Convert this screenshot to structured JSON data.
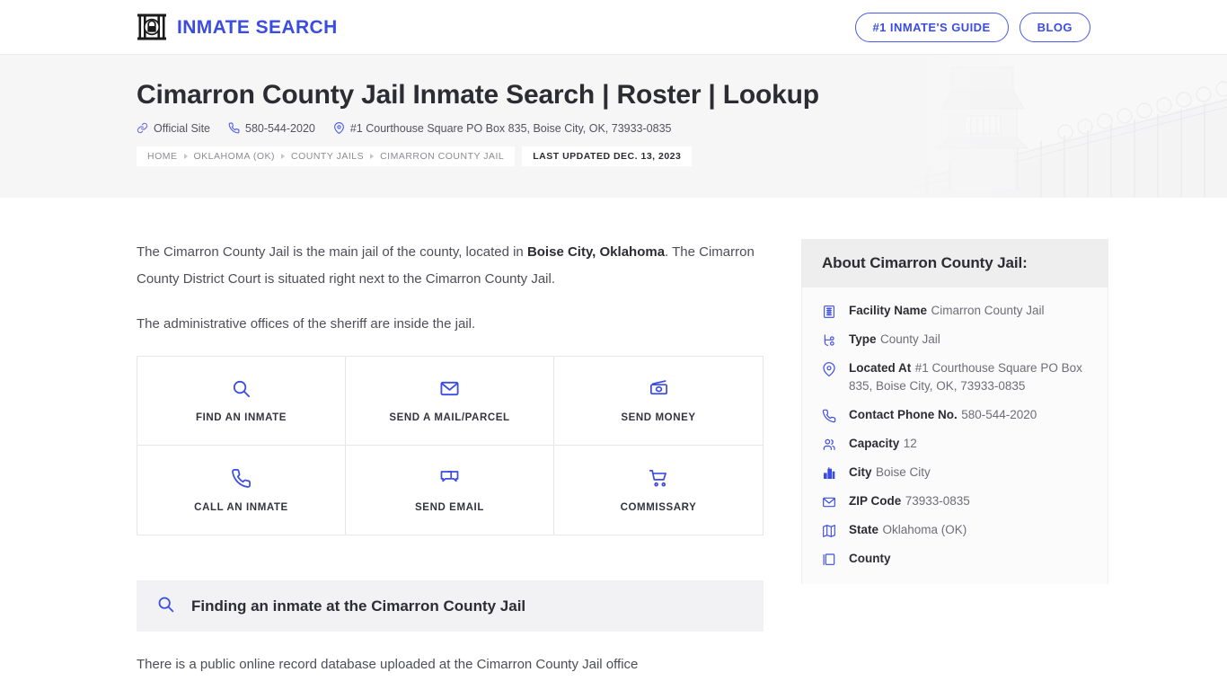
{
  "header": {
    "brand_name": "INMATE SEARCH",
    "logo_icon": "jail-padlock-icon",
    "buttons": [
      {
        "label": "#1 INMATE'S GUIDE",
        "name": "inmates-guide-button"
      },
      {
        "label": "BLOG",
        "name": "blog-button"
      }
    ]
  },
  "hero": {
    "title": "Cimarron County Jail Inmate Search | Roster | Lookup",
    "meta": [
      {
        "icon": "link-icon",
        "text": "Official Site"
      },
      {
        "icon": "phone-icon",
        "text": "580-544-2020"
      },
      {
        "icon": "map-pin-icon",
        "text": "#1 Courthouse Square PO Box 835, Boise City, OK, 73933-0835"
      }
    ],
    "breadcrumb": [
      "HOME",
      "OKLAHOMA (OK)",
      "COUNTY JAILS",
      "CIMARRON COUNTY JAIL"
    ],
    "last_updated": "LAST UPDATED DEC. 13, 2023",
    "background_image": "prison-watchtower-fence-watermark"
  },
  "main": {
    "paragraph_1_a": "The Cimarron County Jail is the main jail of the county, located in ",
    "paragraph_1_b": "Boise City, Oklahoma",
    "paragraph_1_c": ". The Cimarron County District Court is situated right next to the Cimarron County Jail.",
    "paragraph_2": "The administrative offices of the sheriff are inside the jail.",
    "actions": [
      {
        "label": "FIND AN INMATE",
        "icon": "search-icon",
        "name": "find-an-inmate-card"
      },
      {
        "label": "SEND A MAIL/PARCEL",
        "icon": "envelope-icon",
        "name": "send-mail-parcel-card"
      },
      {
        "label": "SEND MONEY",
        "icon": "money-icon",
        "name": "send-money-card"
      },
      {
        "label": "CALL AN INMATE",
        "icon": "phone-icon",
        "name": "call-an-inmate-card"
      },
      {
        "label": "SEND EMAIL",
        "icon": "chat-bubbles-icon",
        "name": "send-email-card"
      },
      {
        "label": "COMMISSARY",
        "icon": "shopping-cart-icon",
        "name": "commissary-card"
      }
    ],
    "section_heading": {
      "icon": "search-icon",
      "title": "Finding an inmate at the Cimarron County Jail"
    },
    "after_section_text": "There is a public online record database uploaded at the Cimarron County Jail office"
  },
  "sidebar": {
    "title": "About Cimarron County Jail:",
    "rows": [
      {
        "icon": "building-grid-icon",
        "label": "Facility Name",
        "value": "Cimarron County Jail"
      },
      {
        "icon": "node-type-icon",
        "label": "Type",
        "value": "County Jail"
      },
      {
        "icon": "map-pin-icon",
        "label": "Located At",
        "value": "#1 Courthouse Square PO Box 835, Boise City, OK, 73933-0835"
      },
      {
        "icon": "phone-icon",
        "label": "Contact Phone No.",
        "value": "580-544-2020"
      },
      {
        "icon": "users-icon",
        "label": "Capacity",
        "value": "12"
      },
      {
        "icon": "city-icon",
        "label": "City",
        "value": "Boise City"
      },
      {
        "icon": "envelope-icon",
        "label": "ZIP Code",
        "value": "73933-0835"
      },
      {
        "icon": "map-icon",
        "label": "State",
        "value": "Oklahoma (OK)"
      },
      {
        "icon": "book-icon",
        "label": "County",
        "value": ""
      }
    ]
  },
  "colors": {
    "brand_blue": "#3b4ce2",
    "text_dark": "#2c2c33",
    "text_body": "#4e4e57",
    "text_muted": "#6d6d77",
    "hero_bg": "#f6f6f7",
    "panel_head_bg": "#eeeeef",
    "section_head_bg": "#f2f2f4",
    "border": "#e7e7ea"
  }
}
